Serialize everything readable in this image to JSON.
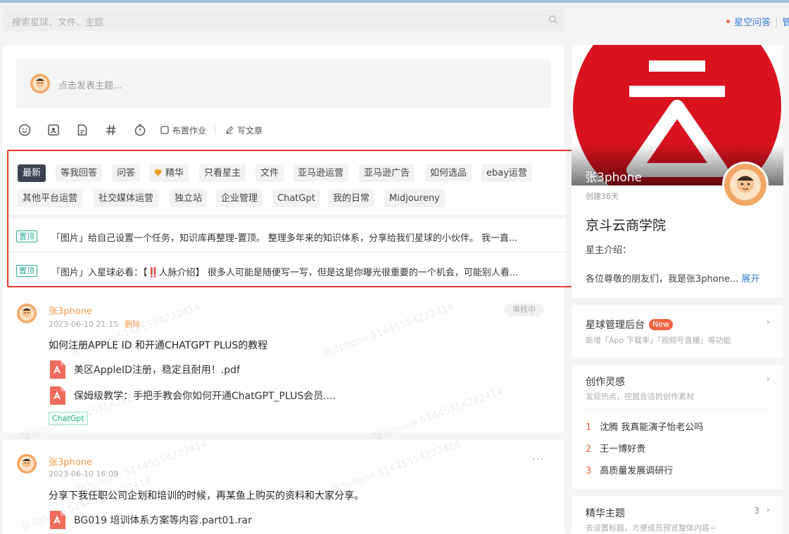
{
  "header": {
    "search_placeholder": "搜索星球、文件、主题",
    "qa_link": "星空问答",
    "truncated_link": "管"
  },
  "composer": {
    "placeholder": "点击发表主题..."
  },
  "toolbar": {
    "icons": [
      "emoji-icon",
      "image-icon",
      "file-icon",
      "hashtag-icon",
      "timer-icon"
    ],
    "assign_label": "布置作业",
    "write_label": "写文章"
  },
  "tags": [
    {
      "label": "最新",
      "active": true
    },
    {
      "label": "等我回答"
    },
    {
      "label": "问答"
    },
    {
      "label": "精华"
    },
    {
      "label": "只看星主"
    },
    {
      "label": "文件"
    },
    {
      "label": "亚马逊运营"
    },
    {
      "label": "亚马逊广告"
    },
    {
      "label": "如何选品"
    },
    {
      "label": "ebay运营"
    },
    {
      "label": "其他平台运营"
    },
    {
      "label": "社交媒体运营"
    },
    {
      "label": "独立站"
    },
    {
      "label": "企业管理"
    },
    {
      "label": "ChatGpt"
    },
    {
      "label": "我的日常"
    },
    {
      "label": "Midjoureny"
    }
  ],
  "pinned": [
    {
      "badge": "置顶",
      "text": "「图片」给自己设置一个任务，知识库再整理-置顶。 整理多年来的知识体系，分享给我们星球的小伙伴。 我一直..."
    },
    {
      "badge": "置顶",
      "text": "「图片」入星球必看：【‼️人脉介绍】 很多人可能是随便写一写，但是这是你曝光很重要的一个机会，可能别人看..."
    }
  ],
  "posts": [
    {
      "author": "张3phone",
      "time": "2023-06-10 21:15",
      "delete_label": "删除",
      "status": "审核中",
      "title": "如何注册APPLE ID 和开通CHATGPT PLUS的教程",
      "files": [
        "美区AppleID注册，稳定且耐用！.pdf",
        "保姆级教学：手把手教会你如何开通ChatGPT_PLUS会员...."
      ],
      "topic": "ChatGpt"
    },
    {
      "author": "张3phone",
      "time": "2023-06-10 16:09",
      "more": "···",
      "title": "分享下我任职公司企划和培训的时候，再某鱼上购买的资料和大家分享。",
      "files": [
        "BG019 培训体系方案等内容.part01.rar"
      ]
    }
  ],
  "watermark": "张3phone 51445554222414",
  "group": {
    "owner_name": "张3phone",
    "created": "创建36天",
    "name": "京斗云商学院",
    "intro_heading": "星主介绍：",
    "intro": "各位尊敬的朋友们，我是张3phone...",
    "expand": "展开",
    "brand_red": "#d9121f"
  },
  "admin": {
    "title": "星球管理后台",
    "new_badge": "New",
    "subtitle": "新增「App 下载率」「视频号直播」等功能"
  },
  "inspiration": {
    "title": "创作灵感",
    "subtitle": "发现热点，挖掘合适的创作素材",
    "items": [
      {
        "num": "1",
        "text": "沈腾 我真能演子怡老公吗"
      },
      {
        "num": "2",
        "text": "王一博好贵"
      },
      {
        "num": "3",
        "text": "高质量发展调研行"
      }
    ]
  },
  "featured": {
    "title": "精华主题",
    "count": "3",
    "subtitle": "去设置标题，方便成员预览整体内容~"
  }
}
